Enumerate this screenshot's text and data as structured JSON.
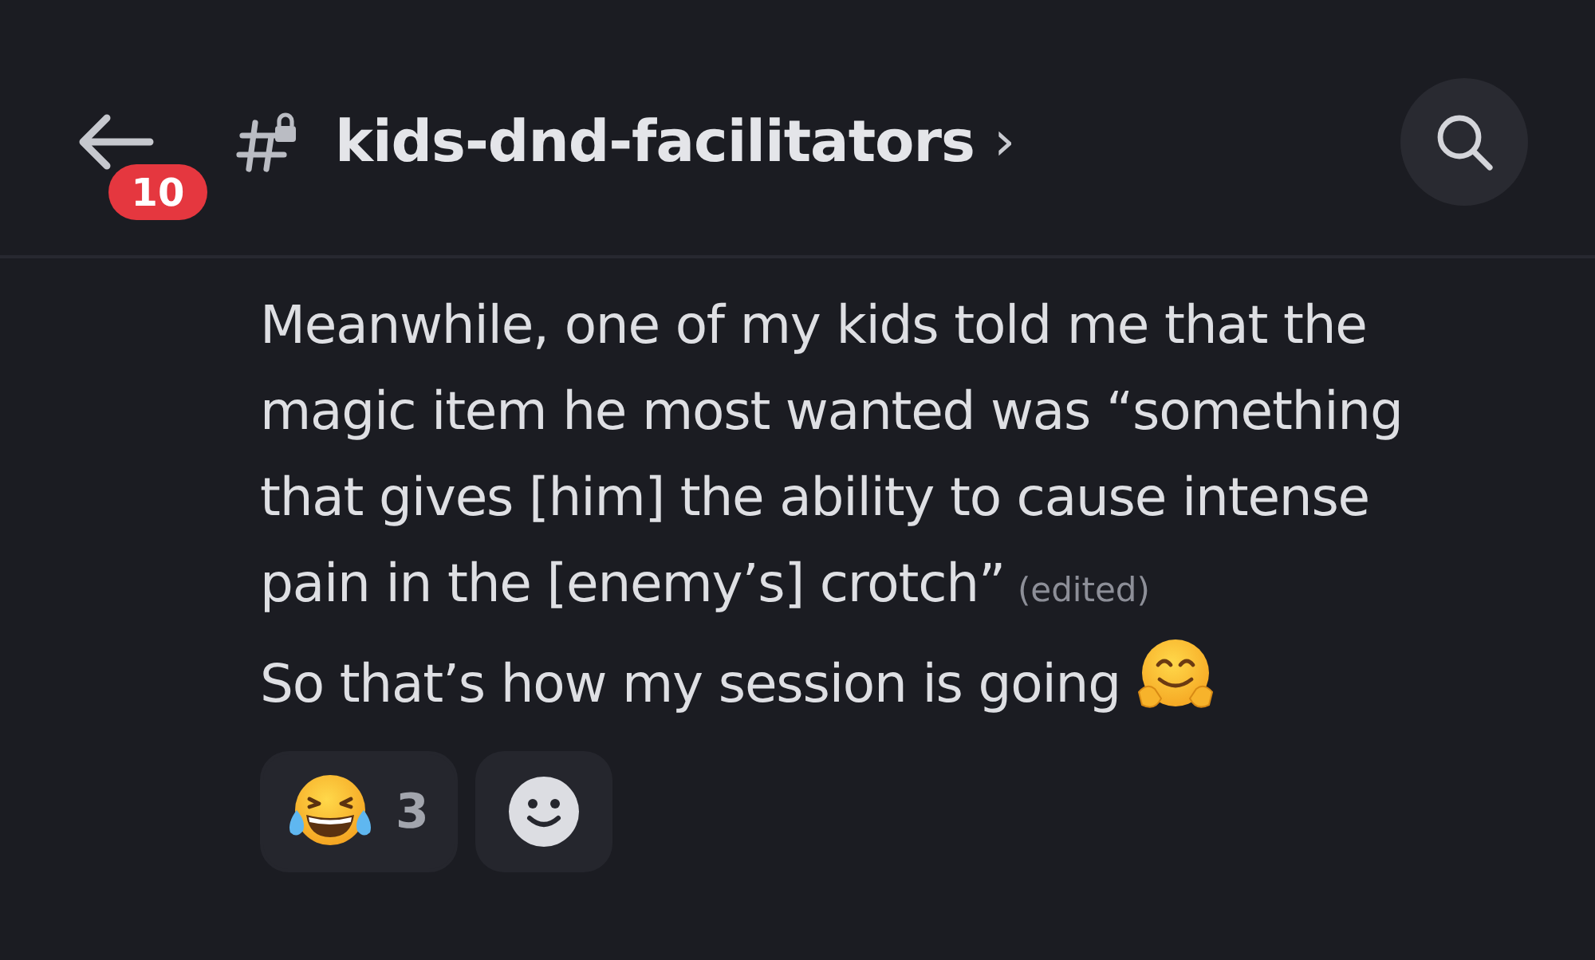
{
  "header": {
    "badge": "10",
    "channel": "kids-dnd-facilitators",
    "chevron": "›"
  },
  "messages": [
    {
      "text": "Meanwhile, one of my kids told me that the magic item he most wanted was “something that gives [him] the ability to cause intense pain in the [enemy’s] crotch”",
      "edited": "(edited)",
      "trailing_emoji": false
    },
    {
      "text": "So that’s how my session is going",
      "trailing_emoji": true
    }
  ],
  "reactions": [
    {
      "kind": "emoji",
      "count": "3",
      "selected": false
    },
    {
      "kind": "add"
    }
  ]
}
